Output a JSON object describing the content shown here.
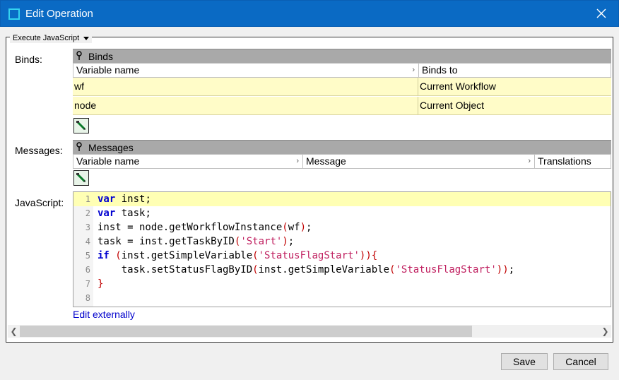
{
  "window": {
    "title": "Edit Operation"
  },
  "group": {
    "legend": "Execute JavaScript"
  },
  "labels": {
    "binds": "Binds:",
    "messages": "Messages:",
    "javascript": "JavaScript:"
  },
  "binds_grid": {
    "header": "Binds",
    "columns": [
      "Variable name",
      "Binds to"
    ],
    "rows": [
      {
        "variable": "wf",
        "binds_to": "Current Workflow"
      },
      {
        "variable": "node",
        "binds_to": "Current Object"
      }
    ]
  },
  "messages_grid": {
    "header": "Messages",
    "columns": [
      "Variable name",
      "Message",
      "Translations"
    ]
  },
  "code": {
    "line_numbers": [
      "1",
      "2",
      "3",
      "4",
      "5",
      "6",
      "7",
      "8"
    ]
  },
  "edit_externally": "Edit externally",
  "buttons": {
    "save": "Save",
    "cancel": "Cancel"
  },
  "colors": {
    "titlebar": "#0a6ac4",
    "row_highlight": "#fffcc8",
    "keyword": "#0000d0",
    "string": "#c02060"
  }
}
